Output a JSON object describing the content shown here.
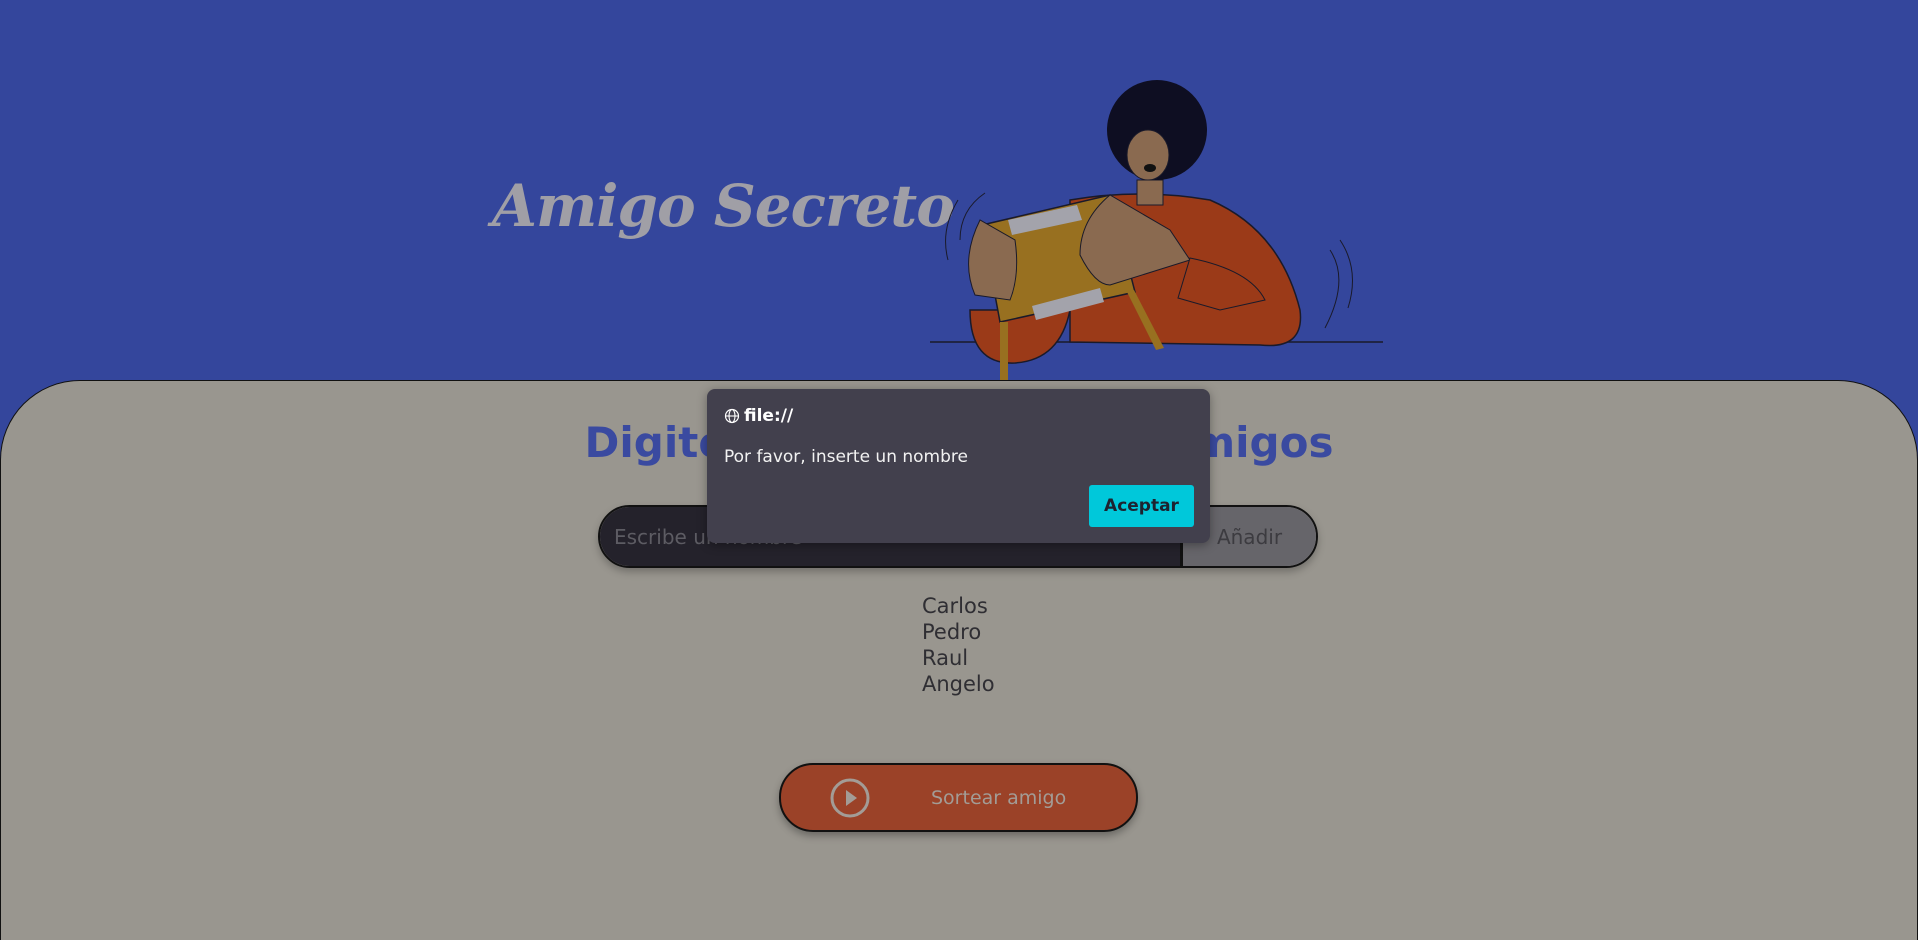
{
  "header": {
    "title": "Amigo Secreto"
  },
  "main": {
    "heading": "Digite el nombre de sus amigos",
    "input": {
      "placeholder": "Escribe un nombre",
      "value": ""
    },
    "add_button": "Añadir",
    "friends": [
      "Carlos",
      "Pedro",
      "Raul",
      "Angelo"
    ],
    "draw_button": "Sortear amigo"
  },
  "dialog": {
    "origin": "file://",
    "message": "Por favor, inserte un nombre",
    "ok_button": "Aceptar"
  },
  "colors": {
    "header_bg": "#34469c",
    "accent_orange": "#9b4228",
    "dialog_button": "#00c8da"
  }
}
